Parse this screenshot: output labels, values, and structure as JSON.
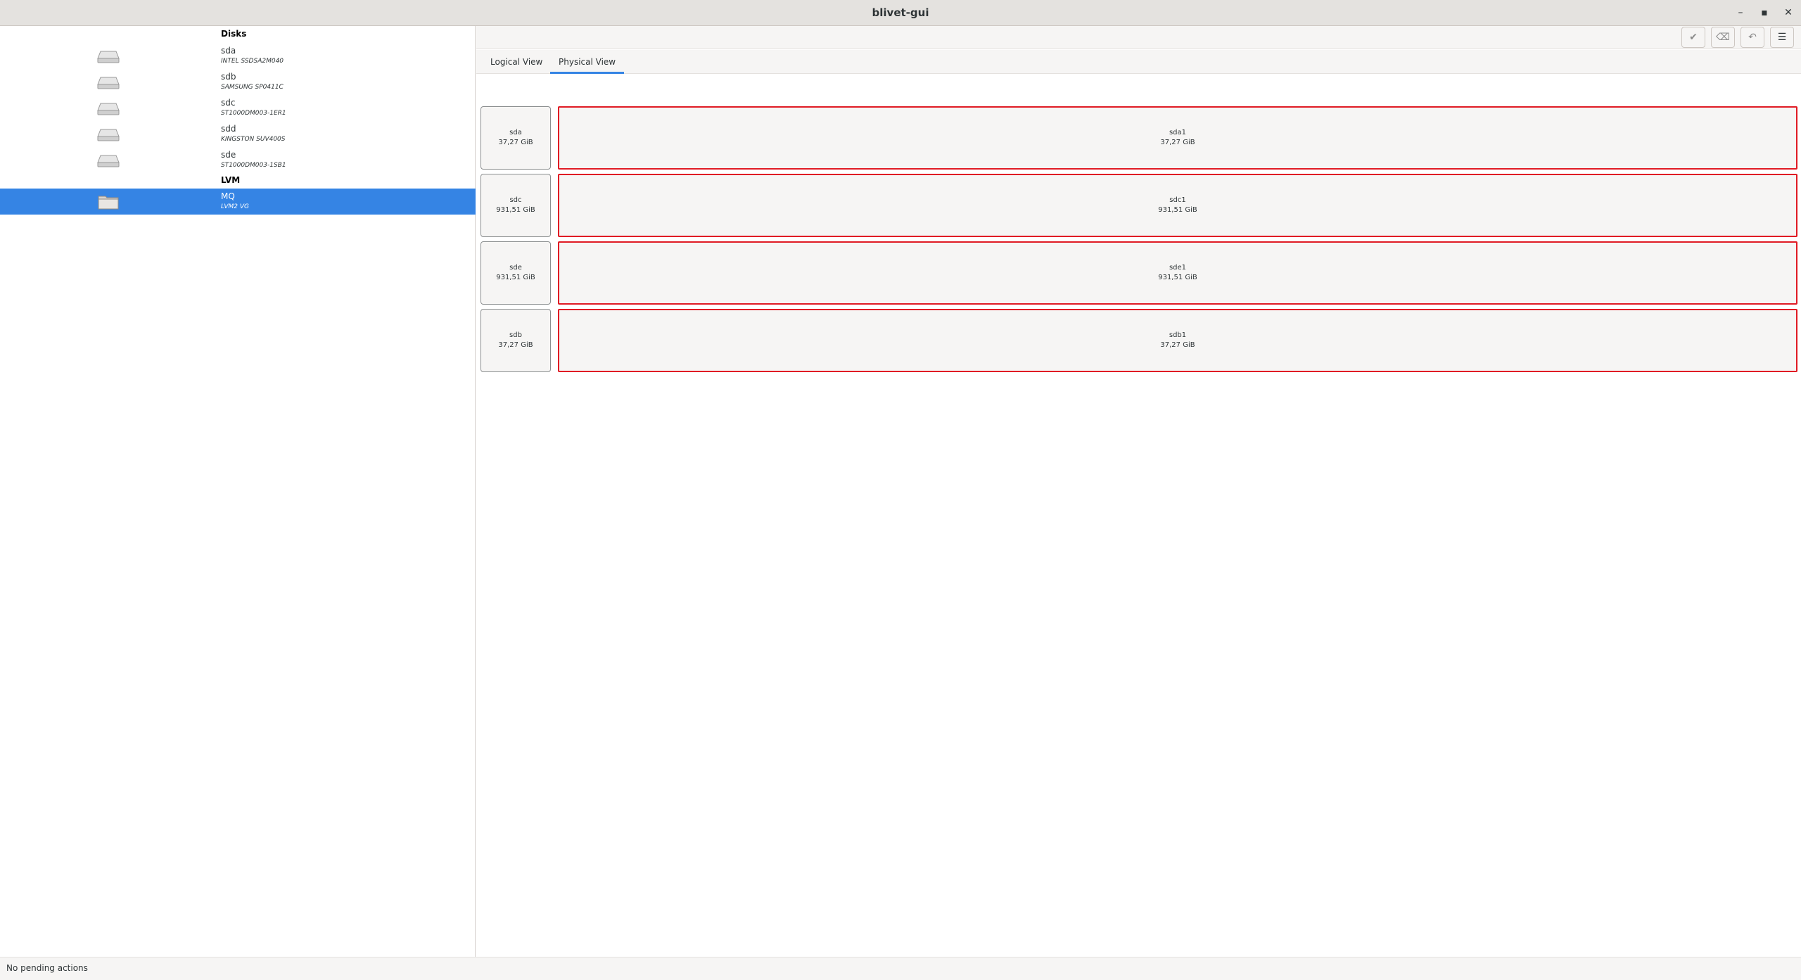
{
  "window": {
    "title": "blivet-gui",
    "minimize_glyph": "–",
    "maximize_glyph": "▪",
    "close_glyph": "✕"
  },
  "sidebar": {
    "disks_header": "Disks",
    "disks": [
      {
        "name": "sda",
        "model": "INTEL SSDSA2M040",
        "icon": "harddisk-icon"
      },
      {
        "name": "sdb",
        "model": "SAMSUNG SP0411C",
        "icon": "harddisk-icon"
      },
      {
        "name": "sdc",
        "model": "ST1000DM003-1ER1",
        "icon": "harddisk-icon"
      },
      {
        "name": "sdd",
        "model": "KINGSTON SUV400S",
        "icon": "harddisk-icon"
      },
      {
        "name": "sde",
        "model": "ST1000DM003-1SB1",
        "icon": "harddisk-icon"
      }
    ],
    "lvm_header": "LVM",
    "lvm": [
      {
        "name": "MQ",
        "model": "LVM2 VG",
        "icon": "volume-group-icon",
        "selected": true
      }
    ]
  },
  "header": {
    "buttons": [
      {
        "name": "apply-button",
        "glyph": "✔",
        "icon": "check-icon"
      },
      {
        "name": "clear-button",
        "glyph": "⌫",
        "icon": "clear-icon"
      },
      {
        "name": "undo-button",
        "glyph": "↶",
        "icon": "undo-icon"
      },
      {
        "name": "menu-button",
        "glyph": "☰",
        "icon": "hamburger-icon"
      }
    ]
  },
  "tabs": [
    {
      "label": "Logical View",
      "active": false
    },
    {
      "label": "Physical View",
      "active": true
    }
  ],
  "physical_view": {
    "rows": [
      {
        "disk": "sda",
        "disk_size": "37,27 GiB",
        "partition": "sda1",
        "partition_size": "37,27 GiB"
      },
      {
        "disk": "sdc",
        "disk_size": "931,51 GiB",
        "partition": "sdc1",
        "partition_size": "931,51 GiB"
      },
      {
        "disk": "sde",
        "disk_size": "931,51 GiB",
        "partition": "sde1",
        "partition_size": "931,51 GiB"
      },
      {
        "disk": "sdb",
        "disk_size": "37,27 GiB",
        "partition": "sdb1",
        "partition_size": "37,27 GiB"
      }
    ]
  },
  "status": {
    "text": "No pending actions"
  },
  "colors": {
    "accent": "#3584e4",
    "partition_border": "#e01b24"
  }
}
